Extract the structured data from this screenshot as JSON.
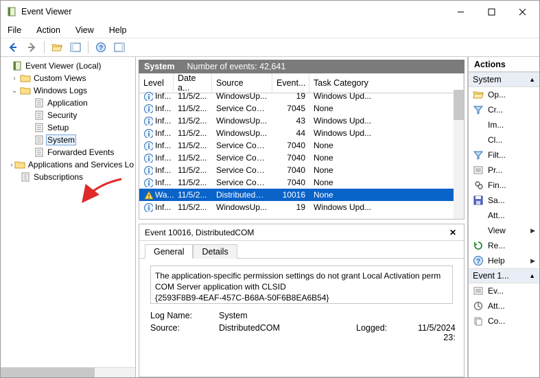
{
  "window": {
    "title": "Event Viewer"
  },
  "menu": [
    "File",
    "Action",
    "View",
    "Help"
  ],
  "tree": {
    "root": "Event Viewer (Local)",
    "nodes": [
      {
        "label": "Custom Views",
        "expander": ">"
      },
      {
        "label": "Windows Logs",
        "expander": "v",
        "children": [
          {
            "label": "Application"
          },
          {
            "label": "Security"
          },
          {
            "label": "Setup"
          },
          {
            "label": "System",
            "highlight": true
          },
          {
            "label": "Forwarded Events"
          }
        ]
      },
      {
        "label": "Applications and Services Lo",
        "expander": ">"
      },
      {
        "label": "Subscriptions"
      }
    ]
  },
  "strip": {
    "title": "System",
    "count_label": "Number of events: 42,641"
  },
  "columns": [
    "Level",
    "Date a...",
    "Source",
    "Event...",
    "Task Category"
  ],
  "rows": [
    {
      "icon": "info",
      "level": "Inf...",
      "date": "11/5/2...",
      "source": "WindowsUp...",
      "id": "19",
      "cat": "Windows Upd..."
    },
    {
      "icon": "info",
      "level": "Inf...",
      "date": "11/5/2...",
      "source": "Service Cont...",
      "id": "7045",
      "cat": "None"
    },
    {
      "icon": "info",
      "level": "Inf...",
      "date": "11/5/2...",
      "source": "WindowsUp...",
      "id": "43",
      "cat": "Windows Upd..."
    },
    {
      "icon": "info",
      "level": "Inf...",
      "date": "11/5/2...",
      "source": "WindowsUp...",
      "id": "44",
      "cat": "Windows Upd..."
    },
    {
      "icon": "info",
      "level": "Inf...",
      "date": "11/5/2...",
      "source": "Service Cont...",
      "id": "7040",
      "cat": "None"
    },
    {
      "icon": "info",
      "level": "Inf...",
      "date": "11/5/2...",
      "source": "Service Cont...",
      "id": "7040",
      "cat": "None"
    },
    {
      "icon": "info",
      "level": "Inf...",
      "date": "11/5/2...",
      "source": "Service Cont...",
      "id": "7040",
      "cat": "None"
    },
    {
      "icon": "info",
      "level": "Inf...",
      "date": "11/5/2...",
      "source": "Service Cont...",
      "id": "7040",
      "cat": "None"
    },
    {
      "icon": "warn",
      "level": "Wa...",
      "date": "11/5/2...",
      "source": "DistributedC...",
      "id": "10016",
      "cat": "None",
      "selected": true
    },
    {
      "icon": "info",
      "level": "Inf...",
      "date": "11/5/2...",
      "source": "WindowsUp...",
      "id": "19",
      "cat": "Windows Upd..."
    }
  ],
  "detail": {
    "title": "Event 10016, DistributedCOM",
    "tabs": [
      "General",
      "Details"
    ],
    "message_l1": "The application-specific permission settings do not grant Local Activation perm",
    "message_l2": "COM Server application with CLSID",
    "message_l3": "{2593F8B9-4EAF-457C-B68A-50F6B8EA6B54}",
    "logname_lbl": "Log Name:",
    "logname_val": "System",
    "source_lbl": "Source:",
    "source_val": "DistributedCOM",
    "logged_lbl": "Logged:",
    "logged_val": "11/5/2024 23:"
  },
  "actions": {
    "title": "Actions",
    "section1": "System",
    "items1": [
      {
        "icon": "folder-open",
        "label": "Op..."
      },
      {
        "icon": "funnel-new",
        "label": "Cr..."
      },
      {
        "icon": "blank",
        "label": "Im..."
      },
      {
        "icon": "blank",
        "label": "Cl..."
      },
      {
        "icon": "funnel",
        "label": "Filt..."
      },
      {
        "icon": "properties",
        "label": "Pr..."
      },
      {
        "icon": "find",
        "label": "Fin..."
      },
      {
        "icon": "save",
        "label": "Sa..."
      },
      {
        "icon": "blank",
        "label": "Att..."
      },
      {
        "icon": "blank",
        "label": "View",
        "arrow": true
      },
      {
        "icon": "refresh",
        "label": "Re..."
      },
      {
        "icon": "help",
        "label": "Help",
        "arrow": true
      }
    ],
    "section2": "Event 1...",
    "items2": [
      {
        "icon": "properties",
        "label": "Ev..."
      },
      {
        "icon": "attach",
        "label": "Att..."
      },
      {
        "icon": "copy",
        "label": "Co..."
      }
    ]
  }
}
